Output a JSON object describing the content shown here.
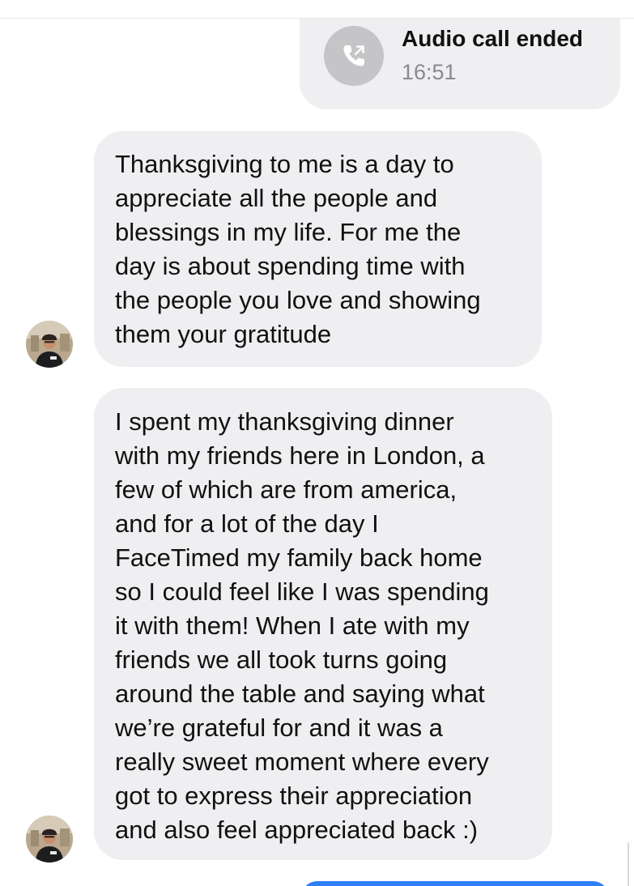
{
  "call": {
    "title": "Audio call ended",
    "time": "16:51",
    "icon": "phone-outgoing-icon"
  },
  "messages": [
    {
      "sender": "contact",
      "text": "Thanksgiving to me is a day to\nappreciate all the people and\nblessings in my life. For me the\nday is about spending time with\nthe people you love and showing\nthem your gratitude"
    },
    {
      "sender": "contact",
      "text": "I spent my thanksgiving dinner\nwith my friends here in London, a\nfew of which are from america,\nand for a lot of the day I\nFaceTimed my family back home\nso I could feel like I was spending\nit with them! When I ate with my\nfriends we all took turns going\naround the table and saying what\nwe’re grateful for and it was a\nreally sweet moment where every\ngot to express their appreciation\nand also feel appreciated back :)"
    }
  ],
  "colors": {
    "incoming_bubble": "#efeff2",
    "outgoing_bubble": "#2f7ef6",
    "call_icon_bg": "#c5c5c8",
    "secondary_text": "#8a8a8e"
  }
}
